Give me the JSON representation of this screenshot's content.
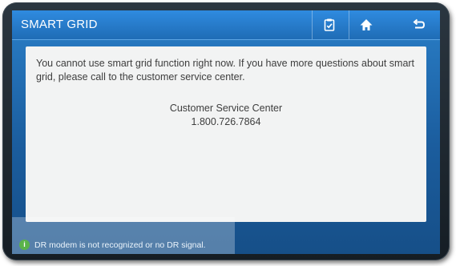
{
  "header": {
    "title": "SMART GRID",
    "buttons": [
      {
        "icon": "clipboard-icon"
      },
      {
        "icon": "home-icon"
      },
      {
        "icon": "back-arrow-icon"
      }
    ]
  },
  "message": {
    "text": "You cannot use smart grid function right now. If you have more questions about smart grid, please call to the customer service center.",
    "service_name": "Customer Service Center",
    "service_phone": "1.800.726.7864"
  },
  "status_bar": {
    "icon": "info-icon",
    "icon_glyph": "i",
    "text": "DR modem is not recognized or no DR signal."
  },
  "colors": {
    "title_bar": "#1f6cb5",
    "screen_background": "#1b5d9e",
    "panel_background": "#f2f3f3",
    "status_icon": "#5ab34a"
  }
}
